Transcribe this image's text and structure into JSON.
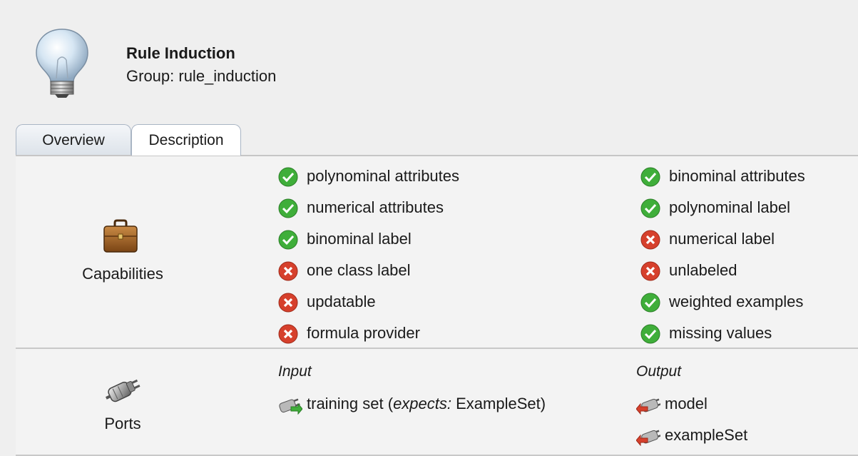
{
  "operator": {
    "title": "Rule Induction",
    "group": "Group: rule_induction",
    "icon": "lightbulb-icon"
  },
  "tabs": [
    {
      "label": "Overview",
      "selected": false
    },
    {
      "label": "Description",
      "selected": true
    }
  ],
  "capabilities": {
    "label": "Capabilities",
    "icon": "briefcase-icon",
    "left": [
      {
        "text": "polynominal attributes",
        "supported": true
      },
      {
        "text": "numerical attributes",
        "supported": true
      },
      {
        "text": "binominal label",
        "supported": true
      },
      {
        "text": "one class label",
        "supported": false
      },
      {
        "text": "updatable",
        "supported": false
      },
      {
        "text": "formula provider",
        "supported": false
      }
    ],
    "right": [
      {
        "text": "binominal attributes",
        "supported": true
      },
      {
        "text": "polynominal label",
        "supported": true
      },
      {
        "text": "numerical label",
        "supported": false
      },
      {
        "text": "unlabeled",
        "supported": false
      },
      {
        "text": "weighted examples",
        "supported": true
      },
      {
        "text": "missing values",
        "supported": true
      }
    ]
  },
  "ports": {
    "label": "Ports",
    "icon": "plug-icon",
    "input_heading": "Input",
    "output_heading": "Output",
    "input": {
      "name": "training set (",
      "expects_label": "expects:",
      "expects_type": " ExampleSet)"
    },
    "output": [
      "model",
      "exampleSet"
    ]
  },
  "colors": {
    "check": "#3fae3a",
    "cross": "#d6402c",
    "tab_border": "#a9b5c4"
  }
}
